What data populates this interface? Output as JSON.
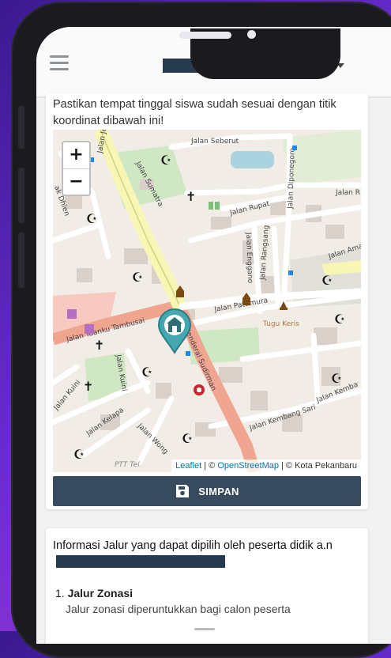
{
  "header": {
    "menu_icon": "hamburger-menu-icon",
    "student_name_redacted": true,
    "dropdown_icon": "caret-down-icon"
  },
  "location_card": {
    "instruction": "Pastikan tempat tinggal siswa sudah sesuai dengan titik koordinat dibawah ini!",
    "map": {
      "zoom_in": "+",
      "zoom_out": "−",
      "marker_icon": "home-marker-icon",
      "labels": {
        "jalan_seberut": "Jalan Seberut",
        "jalan_sumatra": "Jalan Sumatra",
        "jalan_rupat": "Jalan Rupat",
        "jalan_diponegoro": "Jalan Diponegoro",
        "jalan_r": "Jalan R",
        "jalan_enggano": "Jalan Enggano",
        "jalan_rangsang": "Jalan Rangsang",
        "jalan_ama": "Jalan Ama",
        "jalan_pattimura": "Jalan Pattimura",
        "tugu_keris": "Tugu Keris",
        "jalan_tuanku": "Jalan Tuanku Tambusai",
        "jenderal_sudirman": "Jenderal Sudirman",
        "jalan_jende": "Jalan Jende",
        "jalan_kuini": "Jalan Kuini",
        "jalan_kuini2": "Jalan Kuini",
        "jalan_kelapa": "Jalan Kelapa",
        "jalan_wong": "Jalan Wong",
        "jalan_kembang_sari": "Jalan Kembang Sari",
        "jalan_kemba": "Jalan Kemba",
        "ak_dhien": "ak Dhien",
        "ptt_tel": "PTT Tel"
      },
      "attribution": {
        "leaflet": "Leaflet",
        "sep1": " | © ",
        "osm": "OpenStreetMap",
        "sep2": " | © Kota Pekanbaru"
      }
    },
    "save_icon": "floppy-disk-icon",
    "save_label": "SIMPAN"
  },
  "info_card": {
    "title": "Informasi Jalur yang dapat dipilih oleh peserta didik a.n",
    "items": [
      {
        "number": "1.",
        "title": "Jalur Zonasi",
        "description": "Jalur zonasi diperuntukkan bagi calon peserta"
      }
    ]
  },
  "colors": {
    "button": "#374a5e",
    "marker": "#45a7b0",
    "redaction": "#283a4f",
    "main_road": "#f0a591",
    "highway": "#f7f6b5"
  }
}
